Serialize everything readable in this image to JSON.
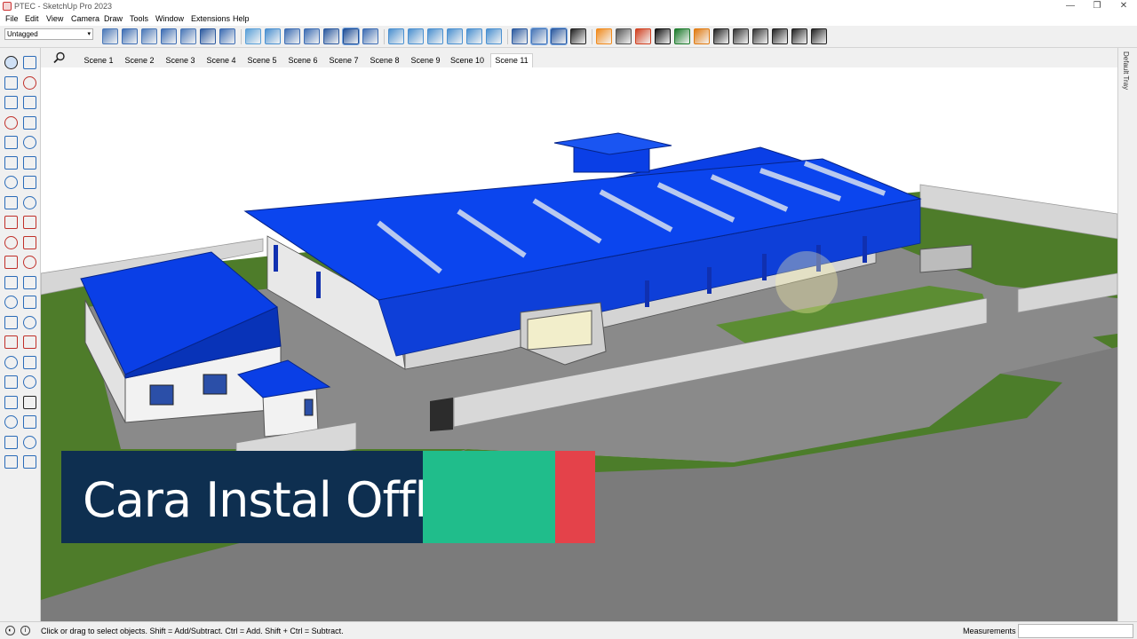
{
  "window": {
    "title": "PTEC - SketchUp Pro 2023",
    "minimize": "—",
    "maximize": "❐",
    "close": "✕"
  },
  "menu": [
    "File",
    "Edit",
    "View",
    "Camera",
    "Draw",
    "Tools",
    "Window",
    "Extensions",
    "Help"
  ],
  "toolbar": {
    "tag_value": "Untagged",
    "icons": [
      "iso-view-icon",
      "top-view-icon",
      "front-view-icon",
      "right-view-icon",
      "back-view-icon",
      "left-view-icon",
      "bottom-view-icon",
      "xray-style-icon",
      "back-edges-style-icon",
      "wireframe-style-icon",
      "hidden-line-style-icon",
      "shaded-style-icon",
      "shaded-textures-style-icon",
      "monochrome-style-icon",
      "outliner-icon",
      "components-icon",
      "entity-info-icon",
      "materials-icon",
      "styles-icon",
      "layers-icon",
      "section-plane-icon",
      "display-section-icon",
      "section-cuts-icon",
      "section-fill-icon",
      "plugin-orange-icon",
      "refresh-icon",
      "sandbox-icon",
      "add-icon",
      "tree-icon",
      "sun-icon",
      "checker-icon",
      "cloud-icon",
      "gear-icon",
      "mail-icon",
      "info-icon",
      "user-icon"
    ]
  },
  "left_tools": [
    "select-icon",
    "lasso-icon",
    "paint-bucket-icon",
    "eraser-icon",
    "components-icon",
    "tag-eraser-icon",
    "line-icon",
    "freehand-icon",
    "rectangle-icon",
    "rotated-rect-icon",
    "circle-icon",
    "polygon-icon",
    "arc-icon",
    "two-point-arc-icon",
    "three-point-arc-icon",
    "pie-icon",
    "move-icon",
    "push-pull-icon",
    "rotate-icon",
    "follow-me-icon",
    "scale-icon",
    "offset-icon",
    "tape-measure-icon",
    "dimension-icon",
    "protractor-icon",
    "text-icon",
    "axes-icon",
    "3d-text-icon",
    "orbit-icon",
    "pan-icon",
    "zoom-icon",
    "zoom-window-icon",
    "zoom-extents-icon",
    "previous-view-icon",
    "position-camera-icon",
    "walk-icon",
    "look-around-icon",
    "section-plane-icon",
    "sandbox-from-contours-icon",
    "sandbox-from-scratch-icon",
    "smoove-icon",
    "stamp-icon"
  ],
  "scenes": {
    "tabs": [
      "Scene 1",
      "Scene 2",
      "Scene 3",
      "Scene 4",
      "Scene 5",
      "Scene 6",
      "Scene 7",
      "Scene 8",
      "Scene 9",
      "Scene 10",
      "Scene 11"
    ],
    "active": "Scene 11"
  },
  "tray": {
    "label": "Default Tray"
  },
  "status": {
    "hint": "Click or drag to select objects. Shift = Add/Subtract. Ctrl = Add. Shift + Ctrl = Subtract.",
    "measurements_label": "Measurements",
    "measurements_value": ""
  },
  "overlay": {
    "text": "Cara Instal Offline",
    "colors": {
      "navy": "#0e2f50",
      "green": "#20bd8b",
      "red": "#e4424a"
    }
  },
  "colors": {
    "roof_blue": "#0a3fd6",
    "grass": "#4a7a26",
    "road": "#7d7d7d",
    "wall": "#dadada"
  }
}
